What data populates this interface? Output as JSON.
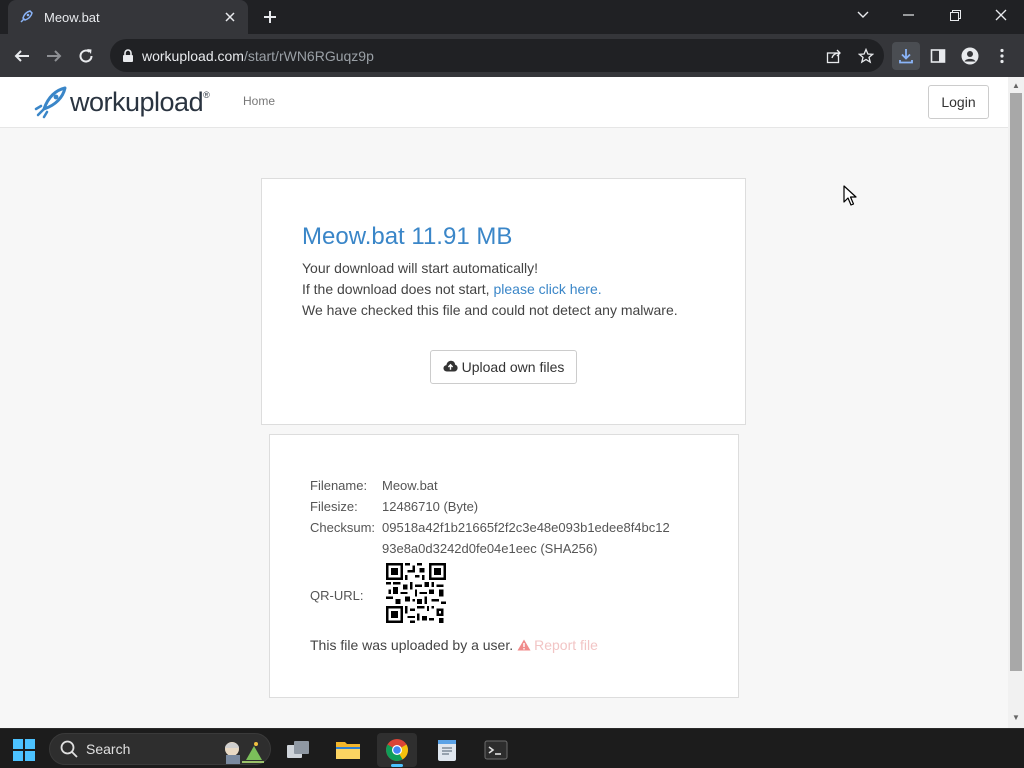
{
  "browser": {
    "tab_title": "Meow.bat",
    "url_domain": "workupload.com",
    "url_path": "/start/rWN6RGuqz9p"
  },
  "site": {
    "logo_text": "workupload",
    "logo_mark": "®",
    "nav_home": "Home",
    "login_label": "Login"
  },
  "download": {
    "title": "Meow.bat 11.91 MB",
    "line1": "Your download will start automatically!",
    "line2_prefix": "If the download does not start, ",
    "line2_link": "please click here.",
    "line3": "We have checked this file and could not detect any malware.",
    "upload_button": "Upload own files"
  },
  "file_info": {
    "filename_label": "Filename:",
    "filename_value": "Meow.bat",
    "filesize_label": "Filesize:",
    "filesize_value": "12486710 (Byte)",
    "checksum_label": "Checksum:",
    "checksum_line1": "09518a42f1b21665f2f2c3e48e093b1edee8f4bc12",
    "checksum_line2": "93e8a0d3242d0fe04e1eec (SHA256)",
    "qr_label": "QR-URL:",
    "uploaded_text": "This file was uploaded by a user.",
    "report_link": "Report file"
  },
  "taskbar": {
    "search_label": "Search"
  },
  "colors": {
    "accent_blue": "#3a86c8",
    "chrome_dark": "#202124",
    "chrome_toolbar": "#35363a",
    "taskbar": "#1c1c1c"
  }
}
